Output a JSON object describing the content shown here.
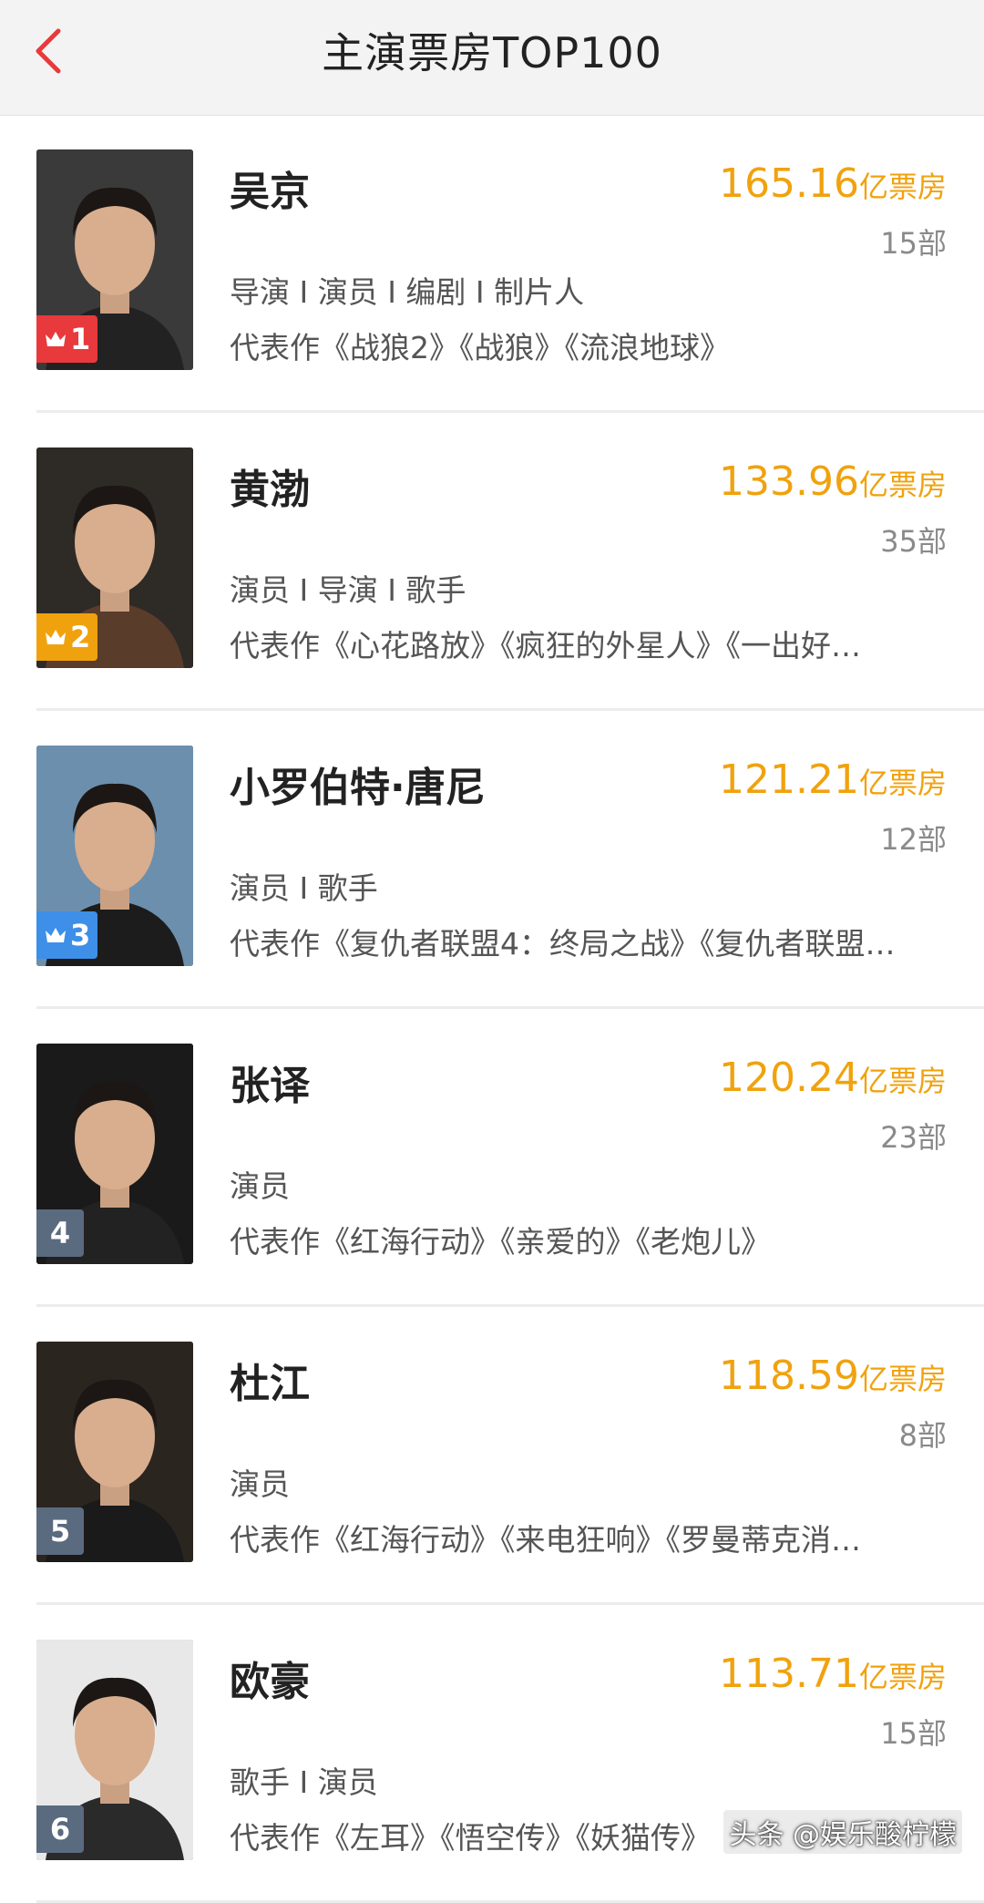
{
  "header": {
    "title": "主演票房TOP100",
    "back_icon": "chevron-left-icon",
    "accent_color": "#e8393c"
  },
  "colors": {
    "box_office": "#f0a20e",
    "rank_1": "#e8393c",
    "rank_2": "#f0a20e",
    "rank_3": "#3d8fe8",
    "rank_default": "#5a6b80"
  },
  "unit_label": "亿票房",
  "actors": [
    {
      "rank": "1",
      "name": "吴京",
      "box_office": "165.16",
      "films": "15部",
      "roles": "导演 I 演员 I 编剧 I 制片人",
      "works": "代表作《战狼2》《战狼》《流浪地球》",
      "crown": true
    },
    {
      "rank": "2",
      "name": "黄渤",
      "box_office": "133.96",
      "films": "35部",
      "roles": "演员 I 导演 I 歌手",
      "works": "代表作《心花路放》《疯狂的外星人》《一出好…",
      "crown": true
    },
    {
      "rank": "3",
      "name": "小罗伯特·唐尼",
      "box_office": "121.21",
      "films": "12部",
      "roles": "演员 I 歌手",
      "works": "代表作《复仇者联盟4：终局之战》《复仇者联盟…",
      "crown": true
    },
    {
      "rank": "4",
      "name": "张译",
      "box_office": "120.24",
      "films": "23部",
      "roles": "演员",
      "works": "代表作《红海行动》《亲爱的》《老炮儿》",
      "crown": false
    },
    {
      "rank": "5",
      "name": "杜江",
      "box_office": "118.59",
      "films": "8部",
      "roles": "演员",
      "works": "代表作《红海行动》《来电狂响》《罗曼蒂克消…",
      "crown": false
    },
    {
      "rank": "6",
      "name": "欧豪",
      "box_office": "113.71",
      "films": "15部",
      "roles": "歌手 I 演员",
      "works": "代表作《左耳》《悟空传》《妖猫传》",
      "crown": false
    }
  ],
  "watermark": "头条 @娱乐酸柠檬"
}
